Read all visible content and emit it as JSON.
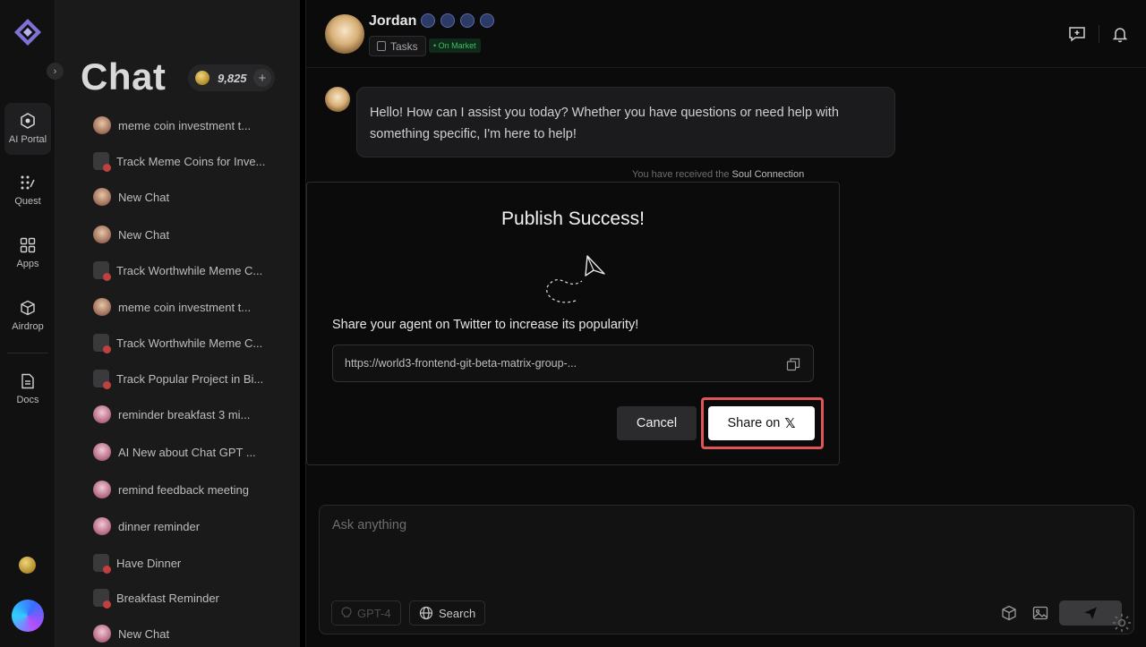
{
  "rail": {
    "items": [
      {
        "label": "AI Portal",
        "icon": "ai-portal-icon"
      },
      {
        "label": "Quest",
        "icon": "quest-icon"
      },
      {
        "label": "Apps",
        "icon": "apps-icon"
      },
      {
        "label": "Airdrop",
        "icon": "airdrop-icon"
      },
      {
        "label": "Docs",
        "icon": "docs-icon"
      }
    ]
  },
  "sidebar": {
    "title": "Chat",
    "balance": "9,825",
    "chats": [
      {
        "title": "meme coin investment t...",
        "avatar": "face"
      },
      {
        "title": "Track Meme Coins for Inve...",
        "avatar": "doc"
      },
      {
        "title": "New Chat",
        "avatar": "face"
      },
      {
        "title": "New Chat",
        "avatar": "face"
      },
      {
        "title": "Track Worthwhile Meme C...",
        "avatar": "doc"
      },
      {
        "title": "meme coin investment t...",
        "avatar": "face"
      },
      {
        "title": "Track Worthwhile Meme C...",
        "avatar": "doc"
      },
      {
        "title": "Track Popular Project in Bi...",
        "avatar": "doc"
      },
      {
        "title": "reminder breakfast 3 mi...",
        "avatar": "pink"
      },
      {
        "title": "AI New about Chat GPT ...",
        "avatar": "pink"
      },
      {
        "title": "remind feedback meeting",
        "avatar": "pink"
      },
      {
        "title": "dinner reminder",
        "avatar": "pink"
      },
      {
        "title": "Have Dinner",
        "avatar": "doc"
      },
      {
        "title": "Breakfast Reminder",
        "avatar": "doc"
      },
      {
        "title": "New Chat",
        "avatar": "pink"
      }
    ]
  },
  "header": {
    "agent_name": "Jordan",
    "tasks_label": "Tasks",
    "market_badge": "• On Market"
  },
  "conversation": {
    "message": "Hello! How can I assist you today? Whether you have questions or need help with something specific, I'm here to help!",
    "received_prefix": "You have received the",
    "received_item": "Soul Connection"
  },
  "composer": {
    "placeholder": "Ask anything",
    "model": "GPT-4",
    "search": "Search"
  },
  "modal": {
    "title": "Publish Success!",
    "description": "Share your agent on Twitter to increase its popularity!",
    "url": "https://world3-frontend-git-beta-matrix-group-...",
    "cancel": "Cancel",
    "share": "Share on",
    "share_icon": "𝕏"
  },
  "colors": {
    "highlight": "#e05555",
    "on_market": "#3fbf6a"
  }
}
